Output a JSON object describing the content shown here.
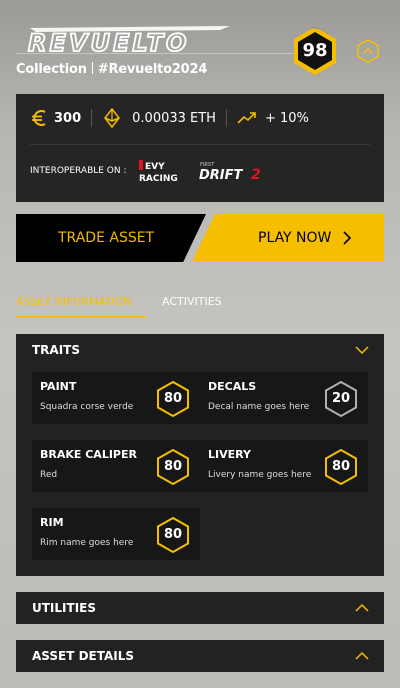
{
  "header": {
    "brand": "REVUELTO",
    "collection_label": "Collection",
    "collection_tag": "#Revuelto2024",
    "score": "98"
  },
  "price": {
    "eur_value": "300",
    "eth_value": "0.00033 ETH",
    "change": "+ 10%",
    "interop_label": "INTEROPERABLE ON :",
    "partners": [
      "REVY RACING",
      "DRIFT 2"
    ]
  },
  "actions": {
    "trade_label": "TRADE ASSET",
    "play_label": "PLAY NOW"
  },
  "tabs": {
    "active": "ASSET INFORMATION",
    "other": "ACTIVITIES"
  },
  "traits": {
    "title": "TRAITS",
    "items": [
      {
        "name": "PAINT",
        "value": "Squadra corse verde",
        "score": "80"
      },
      {
        "name": "DECALS",
        "value": "Decal name goes here",
        "score": "20"
      },
      {
        "name": "BRAKE CALIPER",
        "value": "Red",
        "score": "80"
      },
      {
        "name": "LIVERY",
        "value": "Livery name goes here",
        "score": "80"
      },
      {
        "name": "RIM",
        "value": "Rim name goes here",
        "score": "80"
      }
    ]
  },
  "sections": {
    "utilities": "UTILITIES",
    "asset_details": "ASSET DETAILS"
  },
  "colors": {
    "accent": "#f5bf00",
    "panel": "#222222",
    "tile": "#171717"
  }
}
